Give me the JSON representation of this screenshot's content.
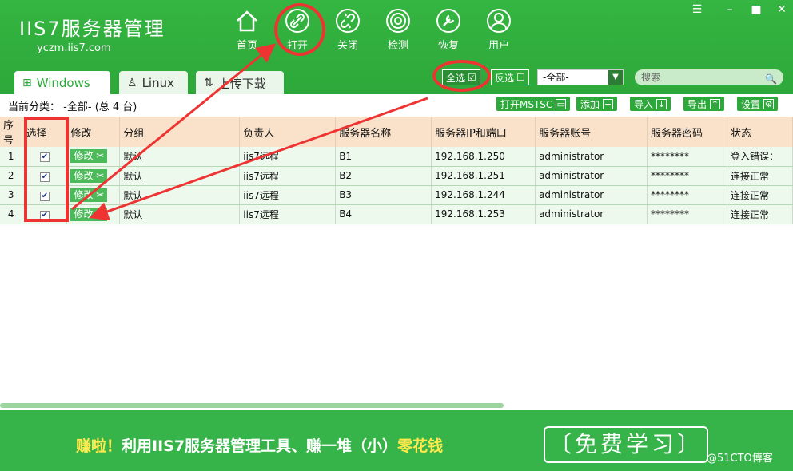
{
  "app": {
    "logo_title": "IIS7服务器管理",
    "logo_url": "yczm.iis7.com"
  },
  "nav": [
    {
      "label": "首页",
      "icon": "home-icon"
    },
    {
      "label": "打开",
      "icon": "link-icon"
    },
    {
      "label": "关闭",
      "icon": "unlink-icon"
    },
    {
      "label": "检测",
      "icon": "radar-icon"
    },
    {
      "label": "恢复",
      "icon": "wrench-icon"
    },
    {
      "label": "用户",
      "icon": "user-icon"
    }
  ],
  "tabs": {
    "windows": "Windows",
    "linux": "Linux",
    "upload": "上传下载"
  },
  "toolbar": {
    "select_all": "全选",
    "invert": "反选",
    "category_value": "-全部-",
    "search_placeholder": "搜索"
  },
  "category": {
    "label": "当前分类：",
    "value": "-全部-",
    "count": "(总 4 台)"
  },
  "actions": {
    "mstsc": "打开MSTSC",
    "add": "添加",
    "import": "导入",
    "export": "导出",
    "settings": "设置"
  },
  "table": {
    "headers": [
      "序号",
      "选择",
      "修改",
      "分组",
      "负责人",
      "服务器名称",
      "服务器IP和端口",
      "服务器账号",
      "服务器密码",
      "状态"
    ],
    "edit_label": "修改",
    "rows": [
      {
        "no": "1",
        "group": "默认",
        "owner": "iis7远程",
        "name": "B1",
        "ip": "192.168.1.250",
        "account": "administrator",
        "password": "********",
        "status": "登入错误："
      },
      {
        "no": "2",
        "group": "默认",
        "owner": "iis7远程",
        "name": "B2",
        "ip": "192.168.1.251",
        "account": "administrator",
        "password": "********",
        "status": "连接正常"
      },
      {
        "no": "3",
        "group": "默认",
        "owner": "iis7远程",
        "name": "B3",
        "ip": "192.168.1.244",
        "account": "administrator",
        "password": "********",
        "status": "连接正常"
      },
      {
        "no": "4",
        "group": "默认",
        "owner": "iis7远程",
        "name": "B4",
        "ip": "192.168.1.253",
        "account": "administrator",
        "password": "********",
        "status": "连接正常"
      }
    ]
  },
  "footer": {
    "slogan_prefix": "赚啦！",
    "slogan_main": "利用IIS7服务器管理工具、赚一堆（小）",
    "slogan_suffix": "零花钱",
    "free_button": "〔免费学习〕",
    "watermark": "@51CTO博客"
  },
  "colors": {
    "brand_green": "#2da83a",
    "annotation_red": "#e33"
  }
}
